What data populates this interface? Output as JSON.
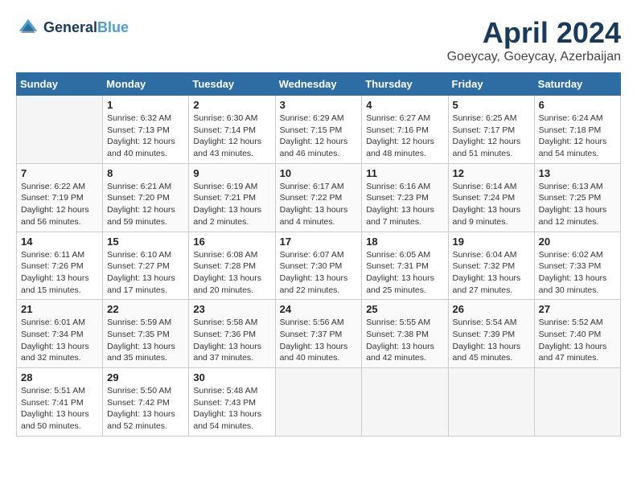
{
  "header": {
    "logo_line1": "General",
    "logo_line2": "Blue",
    "month": "April 2024",
    "location": "Goeycay, Goeycay, Azerbaijan"
  },
  "weekdays": [
    "Sunday",
    "Monday",
    "Tuesday",
    "Wednesday",
    "Thursday",
    "Friday",
    "Saturday"
  ],
  "weeks": [
    [
      {
        "empty": true
      },
      {
        "day": "1",
        "sunrise": "6:32 AM",
        "sunset": "7:13 PM",
        "daylight": "12 hours and 40 minutes."
      },
      {
        "day": "2",
        "sunrise": "6:30 AM",
        "sunset": "7:14 PM",
        "daylight": "12 hours and 43 minutes."
      },
      {
        "day": "3",
        "sunrise": "6:29 AM",
        "sunset": "7:15 PM",
        "daylight": "12 hours and 46 minutes."
      },
      {
        "day": "4",
        "sunrise": "6:27 AM",
        "sunset": "7:16 PM",
        "daylight": "12 hours and 48 minutes."
      },
      {
        "day": "5",
        "sunrise": "6:25 AM",
        "sunset": "7:17 PM",
        "daylight": "12 hours and 51 minutes."
      },
      {
        "day": "6",
        "sunrise": "6:24 AM",
        "sunset": "7:18 PM",
        "daylight": "12 hours and 54 minutes."
      }
    ],
    [
      {
        "day": "7",
        "sunrise": "6:22 AM",
        "sunset": "7:19 PM",
        "daylight": "12 hours and 56 minutes."
      },
      {
        "day": "8",
        "sunrise": "6:21 AM",
        "sunset": "7:20 PM",
        "daylight": "12 hours and 59 minutes."
      },
      {
        "day": "9",
        "sunrise": "6:19 AM",
        "sunset": "7:21 PM",
        "daylight": "13 hours and 2 minutes."
      },
      {
        "day": "10",
        "sunrise": "6:17 AM",
        "sunset": "7:22 PM",
        "daylight": "13 hours and 4 minutes."
      },
      {
        "day": "11",
        "sunrise": "6:16 AM",
        "sunset": "7:23 PM",
        "daylight": "13 hours and 7 minutes."
      },
      {
        "day": "12",
        "sunrise": "6:14 AM",
        "sunset": "7:24 PM",
        "daylight": "13 hours and 9 minutes."
      },
      {
        "day": "13",
        "sunrise": "6:13 AM",
        "sunset": "7:25 PM",
        "daylight": "13 hours and 12 minutes."
      }
    ],
    [
      {
        "day": "14",
        "sunrise": "6:11 AM",
        "sunset": "7:26 PM",
        "daylight": "13 hours and 15 minutes."
      },
      {
        "day": "15",
        "sunrise": "6:10 AM",
        "sunset": "7:27 PM",
        "daylight": "13 hours and 17 minutes."
      },
      {
        "day": "16",
        "sunrise": "6:08 AM",
        "sunset": "7:28 PM",
        "daylight": "13 hours and 20 minutes."
      },
      {
        "day": "17",
        "sunrise": "6:07 AM",
        "sunset": "7:30 PM",
        "daylight": "13 hours and 22 minutes."
      },
      {
        "day": "18",
        "sunrise": "6:05 AM",
        "sunset": "7:31 PM",
        "daylight": "13 hours and 25 minutes."
      },
      {
        "day": "19",
        "sunrise": "6:04 AM",
        "sunset": "7:32 PM",
        "daylight": "13 hours and 27 minutes."
      },
      {
        "day": "20",
        "sunrise": "6:02 AM",
        "sunset": "7:33 PM",
        "daylight": "13 hours and 30 minutes."
      }
    ],
    [
      {
        "day": "21",
        "sunrise": "6:01 AM",
        "sunset": "7:34 PM",
        "daylight": "13 hours and 32 minutes."
      },
      {
        "day": "22",
        "sunrise": "5:59 AM",
        "sunset": "7:35 PM",
        "daylight": "13 hours and 35 minutes."
      },
      {
        "day": "23",
        "sunrise": "5:58 AM",
        "sunset": "7:36 PM",
        "daylight": "13 hours and 37 minutes."
      },
      {
        "day": "24",
        "sunrise": "5:56 AM",
        "sunset": "7:37 PM",
        "daylight": "13 hours and 40 minutes."
      },
      {
        "day": "25",
        "sunrise": "5:55 AM",
        "sunset": "7:38 PM",
        "daylight": "13 hours and 42 minutes."
      },
      {
        "day": "26",
        "sunrise": "5:54 AM",
        "sunset": "7:39 PM",
        "daylight": "13 hours and 45 minutes."
      },
      {
        "day": "27",
        "sunrise": "5:52 AM",
        "sunset": "7:40 PM",
        "daylight": "13 hours and 47 minutes."
      }
    ],
    [
      {
        "day": "28",
        "sunrise": "5:51 AM",
        "sunset": "7:41 PM",
        "daylight": "13 hours and 50 minutes."
      },
      {
        "day": "29",
        "sunrise": "5:50 AM",
        "sunset": "7:42 PM",
        "daylight": "13 hours and 52 minutes."
      },
      {
        "day": "30",
        "sunrise": "5:48 AM",
        "sunset": "7:43 PM",
        "daylight": "13 hours and 54 minutes."
      },
      {
        "empty": true
      },
      {
        "empty": true
      },
      {
        "empty": true
      },
      {
        "empty": true
      }
    ]
  ]
}
